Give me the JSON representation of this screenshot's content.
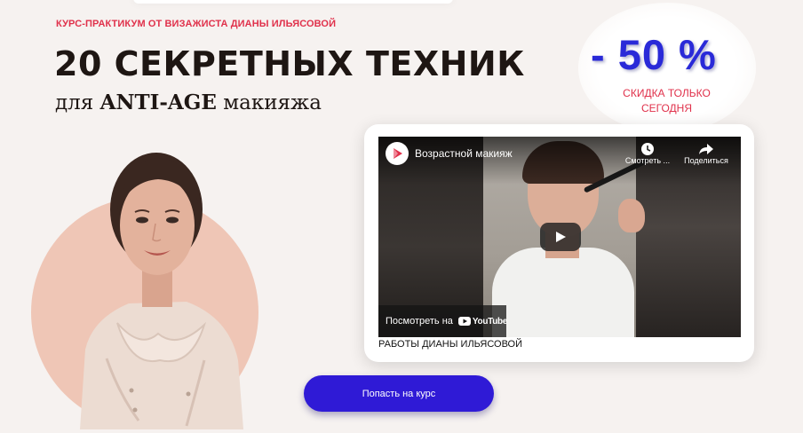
{
  "hero": {
    "kicker": "КУРС-ПРАКТИКУМ ОТ ВИЗАЖИСТА ДИАНЫ ИЛЬЯСОВОЙ",
    "headline": "20 СЕКРЕТНЫХ ТЕХНИК",
    "subheadline": {
      "pre": "для ",
      "bold": "ANTI-AGE",
      "post": " макияжа"
    }
  },
  "discount": {
    "value": "- 50 %",
    "caption": "СКИДКА ТОЛЬКО СЕГОДНЯ",
    "color": "#2a2ad8"
  },
  "video": {
    "title": "Возрастной макияж",
    "watch_later_label": "Смотреть ...",
    "share_label": "Поделиться",
    "watch_on_label": "Посмотреть на",
    "youtube_logo_text": "YouTube",
    "caption": "РАБОТЫ ДИАНЫ ИЛЬЯСОВОЙ",
    "icons": [
      "channel-avatar-icon",
      "clock-icon",
      "share-icon",
      "play-icon",
      "youtube-logo-icon"
    ]
  },
  "cta": {
    "label": "Попасть на курс",
    "color": "#2f1ad6"
  },
  "colors": {
    "accent_red": "#e0314b",
    "portrait_circle": "#efc6b6",
    "background": "#f6f2f0"
  }
}
